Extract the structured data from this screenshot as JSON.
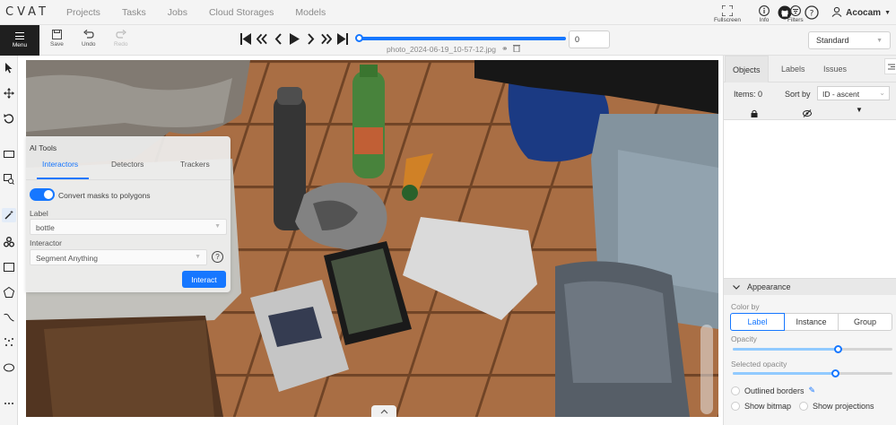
{
  "app": {
    "logo": "CVAT"
  },
  "nav": {
    "links": [
      "Projects",
      "Tasks",
      "Jobs",
      "Cloud Storages",
      "Models"
    ],
    "user": "Acocam",
    "icons": [
      "github-icon",
      "help-icon",
      "user-icon"
    ]
  },
  "toolbar": {
    "menu_label": "Menu",
    "save_label": "Save",
    "undo_label": "Undo",
    "redo_label": "Redo",
    "filename": "photo_2024-06-19_10-57-12.jpg",
    "frame_value": "0",
    "frame_progress": 1.0,
    "fullscreen_label": "Fullscreen",
    "info_label": "Info",
    "filters_label": "Filters",
    "workspace": "Standard"
  },
  "ai_tools": {
    "title": "AI Tools",
    "tabs": [
      "Interactors",
      "Detectors",
      "Trackers"
    ],
    "active_tab": "Interactors",
    "convert_label": "Convert masks to polygons",
    "convert_enabled": true,
    "label_caption": "Label",
    "label_value": "bottle",
    "interactor_caption": "Interactor",
    "interactor_value": "Segment Anything",
    "interact_button": "Interact"
  },
  "objects_panel": {
    "tabs": [
      "Objects",
      "Labels",
      "Issues"
    ],
    "active_tab": "Objects",
    "items_label": "Items: 0",
    "sort_label": "Sort by",
    "sort_value": "ID - ascent"
  },
  "appearance": {
    "title": "Appearance",
    "color_by_label": "Color by",
    "color_by_options": [
      "Label",
      "Instance",
      "Group"
    ],
    "color_by_selected": "Label",
    "opacity_label": "Opacity",
    "opacity_value": 0.66,
    "selected_opacity_label": "Selected opacity",
    "selected_opacity_value": 0.64,
    "outlined_borders_label": "Outlined borders",
    "show_bitmap_label": "Show bitmap",
    "show_projections_label": "Show projections"
  },
  "colors": {
    "accent": "#1677ff",
    "menu_bg": "#1f1f1f"
  }
}
